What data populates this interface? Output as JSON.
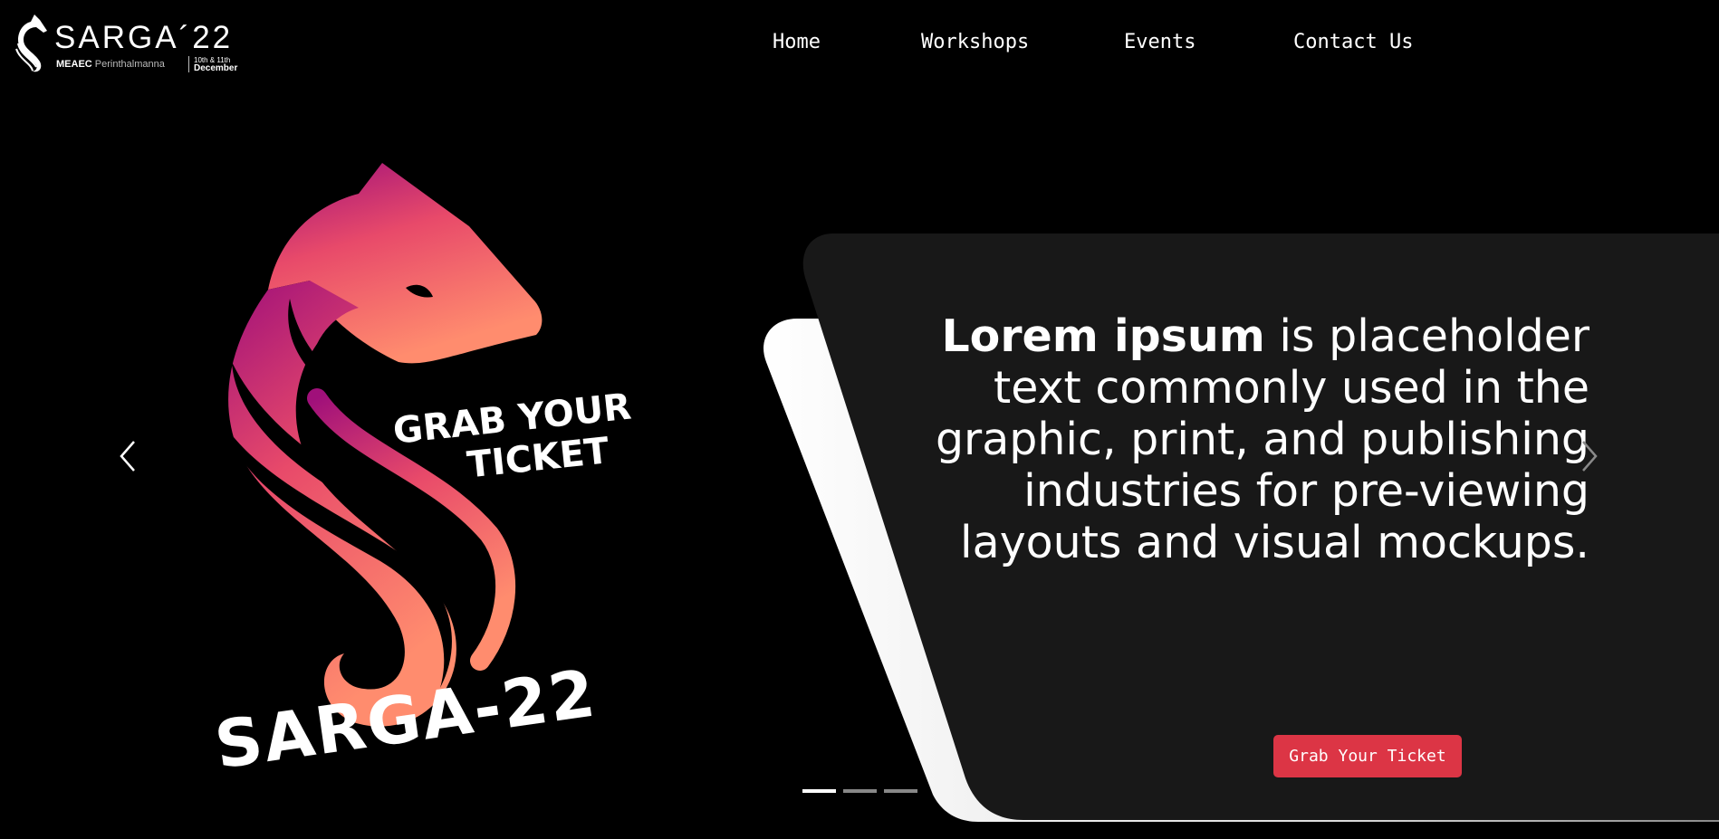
{
  "brand": {
    "title": "SARGA´22",
    "org": "MEAEC",
    "place": "Perinthalmanna",
    "date_days": "10th & 11th",
    "date_month": "December"
  },
  "nav": {
    "items": [
      {
        "label": "Home"
      },
      {
        "label": "Workshops"
      },
      {
        "label": "Events"
      },
      {
        "label": "Contact Us"
      }
    ]
  },
  "hero": {
    "poster_line1": "GRAB YOUR",
    "poster_line2": "TICKET",
    "poster_title": "SARGA-22",
    "text_bold": "Lorem ipsum",
    "text_rest": " is placeholder text commonly used in the graphic, print, and publishing industries for pre-viewing layouts and visual mockups.",
    "cta_label": "Grab Your Ticket",
    "slides": 3,
    "active_slide": 1
  },
  "colors": {
    "background": "#000000",
    "card": "#181818",
    "cta": "#dc3545",
    "gradient_top": "#a0107a",
    "gradient_mid": "#e84a6a",
    "gradient_bottom": "#ff8c6e"
  },
  "icons": {
    "prev": "chevron-left-icon",
    "next": "chevron-right-icon",
    "logo": "horse-head-logo"
  }
}
